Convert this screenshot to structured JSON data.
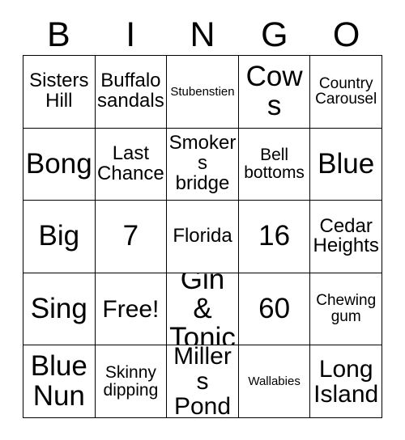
{
  "header": {
    "letters": [
      "B",
      "I",
      "N",
      "G",
      "O"
    ]
  },
  "grid": {
    "columns": 5,
    "rows": 5,
    "cells": [
      {
        "text": "Sisters Hill",
        "size": "md"
      },
      {
        "text": "Buffalo sandals",
        "size": "md"
      },
      {
        "text": "Stubenstien",
        "size": "xxs"
      },
      {
        "text": "Cows",
        "size": "xl"
      },
      {
        "text": "Country Carousel",
        "size": "xs"
      },
      {
        "text": "Bong",
        "size": "xl"
      },
      {
        "text": "Last Chance",
        "size": "md"
      },
      {
        "text": "Smokers bridge",
        "size": "md"
      },
      {
        "text": "Bell bottoms",
        "size": "sm"
      },
      {
        "text": "Blue",
        "size": "xl"
      },
      {
        "text": "Big",
        "size": "xl"
      },
      {
        "text": "7",
        "size": "xl"
      },
      {
        "text": "Florida",
        "size": "md"
      },
      {
        "text": "16",
        "size": "xl"
      },
      {
        "text": "Cedar Heights",
        "size": "md"
      },
      {
        "text": "Sing",
        "size": "xl"
      },
      {
        "text": "Free!",
        "size": "lg"
      },
      {
        "text": "Gin & Tonic",
        "size": "xl"
      },
      {
        "text": "60",
        "size": "xl"
      },
      {
        "text": "Chewing gum",
        "size": "xs"
      },
      {
        "text": "Blue Nun",
        "size": "xl"
      },
      {
        "text": "Skinny dipping",
        "size": "sm"
      },
      {
        "text": "Millers Pond",
        "size": "lg"
      },
      {
        "text": "Wallabies",
        "size": "xxs"
      },
      {
        "text": "Long Island",
        "size": "lg"
      }
    ]
  },
  "colors": {
    "border": "#000000",
    "text": "#000000",
    "background": "#ffffff"
  }
}
